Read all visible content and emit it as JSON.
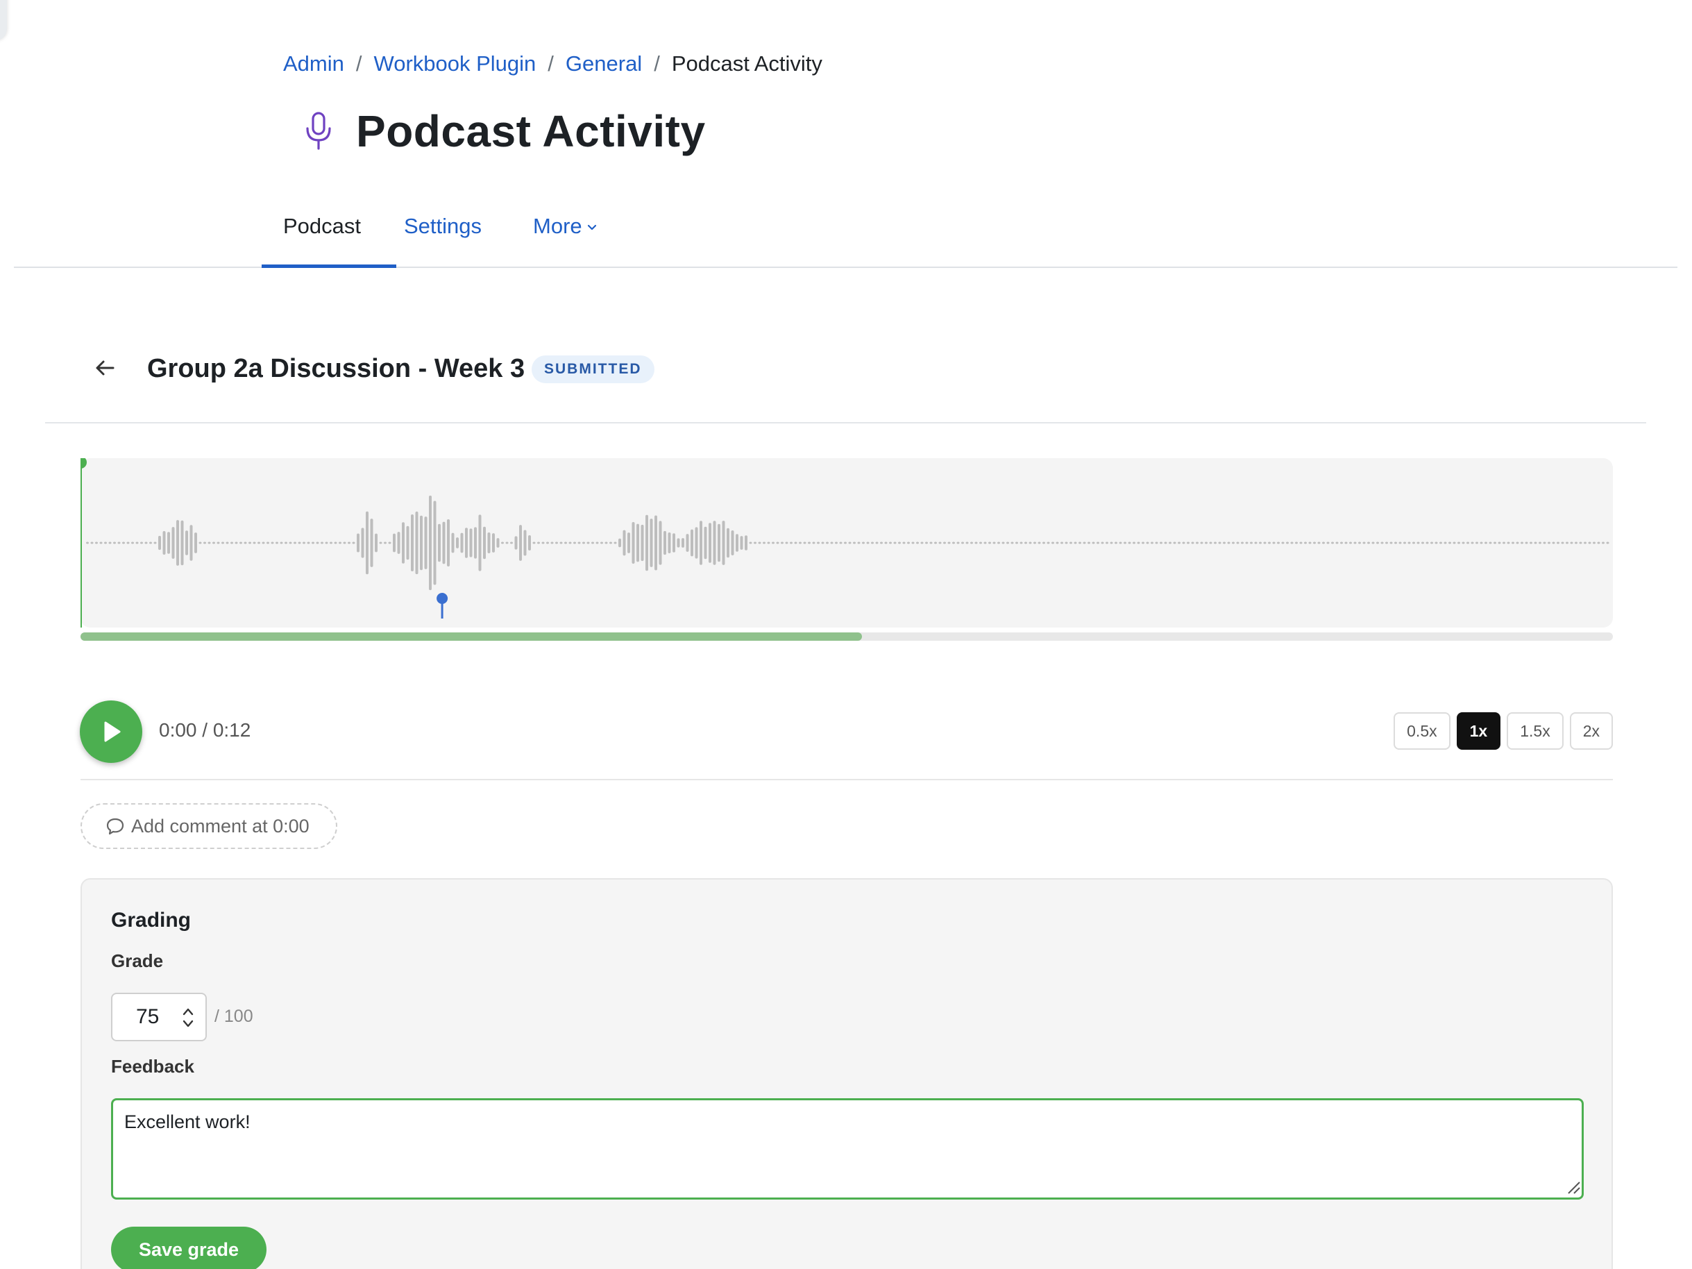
{
  "breadcrumb": {
    "items": [
      "Admin",
      "Workbook Plugin",
      "General"
    ],
    "separator": "/",
    "current": "Podcast Activity"
  },
  "page": {
    "title": "Podcast Activity",
    "icon": "microphone-icon",
    "accent_color": "#6f42c1"
  },
  "tabs": {
    "podcast": "Podcast",
    "settings": "Settings",
    "more": "More"
  },
  "submission": {
    "title": "Group 2a Discussion - Week 3",
    "status": "SUBMITTED"
  },
  "player": {
    "time": "0:00 / 0:12",
    "progress_fraction": 0.51,
    "comment_marker_fraction": 0.236,
    "speeds": [
      "0.5x",
      "1x",
      "1.5x",
      "2x"
    ],
    "active_speed": "1x",
    "colors": {
      "accent": "#4caf50",
      "wave": "#bdbdbd",
      "marker": "#3a6fd0"
    }
  },
  "comment": {
    "label": "Add comment at 0:00"
  },
  "grading": {
    "title": "Grading",
    "grade_label": "Grade",
    "grade_value": "75",
    "grade_max": "/ 100",
    "feedback_label": "Feedback",
    "feedback_value": "Excellent work!",
    "save_label": "Save grade"
  }
}
